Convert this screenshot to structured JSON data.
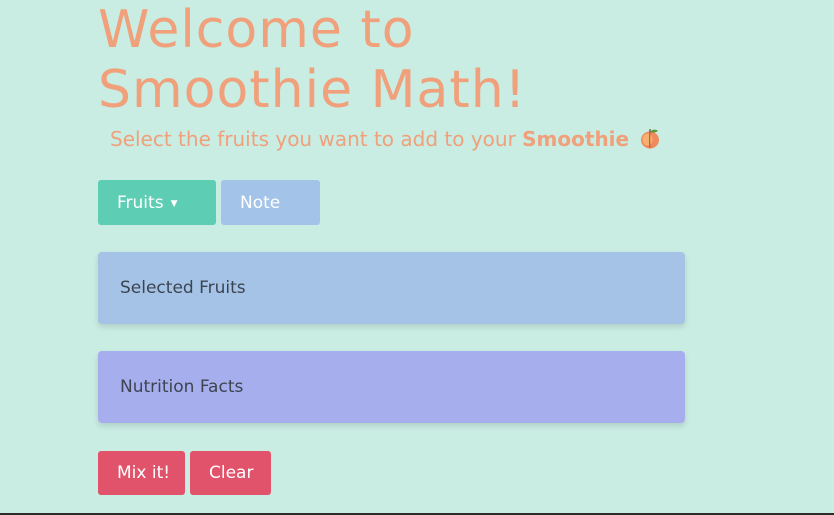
{
  "header": {
    "title_line1": "Welcome to",
    "title_line2": "Smoothie Math!",
    "subtitle_prefix": "Select the fruits you want to add to your",
    "subtitle_strong": "Smoothie",
    "subtitle_icon": "peach-icon"
  },
  "toolbar": {
    "fruits_label": "Fruits",
    "fruits_caret": "▼",
    "note_label": "Note"
  },
  "panels": {
    "selected_fruits_label": "Selected Fruits",
    "nutrition_facts_label": "Nutrition Facts"
  },
  "actions": {
    "mix_label": "Mix it!",
    "clear_label": "Clear"
  },
  "colors": {
    "background": "#c9ece3",
    "title": "#f0a07a",
    "fruits_button": "#5dcdb3",
    "note_button": "#a3c3e8",
    "selected_panel": "#a4c3e7",
    "nutrition_panel": "#a6aeee",
    "action_buttons": "#e0536b"
  }
}
